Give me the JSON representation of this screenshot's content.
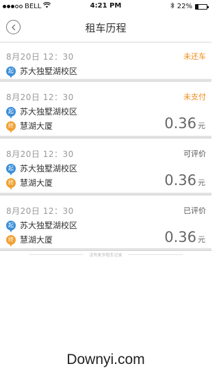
{
  "statusbar": {
    "carrier": "BELL",
    "time": "4:21 PM",
    "battery_pct": "22%",
    "battery_level": 0.22,
    "signal_dots": 5,
    "signal_filled": 3
  },
  "header": {
    "title": "租车历程",
    "back_icon": "chevron-left-icon"
  },
  "trips": [
    {
      "time": "8月20日 12：30",
      "status": "未还车",
      "status_color": "#f08c1e",
      "start_badge": "起",
      "start": "苏大独墅湖校区",
      "end_badge": "",
      "end": "",
      "fare": "",
      "unit": ""
    },
    {
      "time": "8月20日 12：30",
      "status": "未支付",
      "status_color": "#f08c1e",
      "start_badge": "起",
      "start": "苏大独墅湖校区",
      "end_badge": "终",
      "end": "慧湖大厦",
      "fare": "0.36",
      "unit": "元"
    },
    {
      "time": "8月20日 12：30",
      "status": "可评价",
      "status_color": "#555555",
      "start_badge": "起",
      "start": "苏大独墅湖校区",
      "end_badge": "终",
      "end": "慧湖大厦",
      "fare": "0.36",
      "unit": "元"
    },
    {
      "time": "8月20日 12：30",
      "status": "已评价",
      "status_color": "#555555",
      "start_badge": "起",
      "start": "苏大独墅湖校区",
      "end_badge": "终",
      "end": "慧湖大厦",
      "fare": "0.36",
      "unit": "元"
    }
  ],
  "footer": {
    "no_more": "没有更多租车记录"
  },
  "watermark": "Downyi.com"
}
